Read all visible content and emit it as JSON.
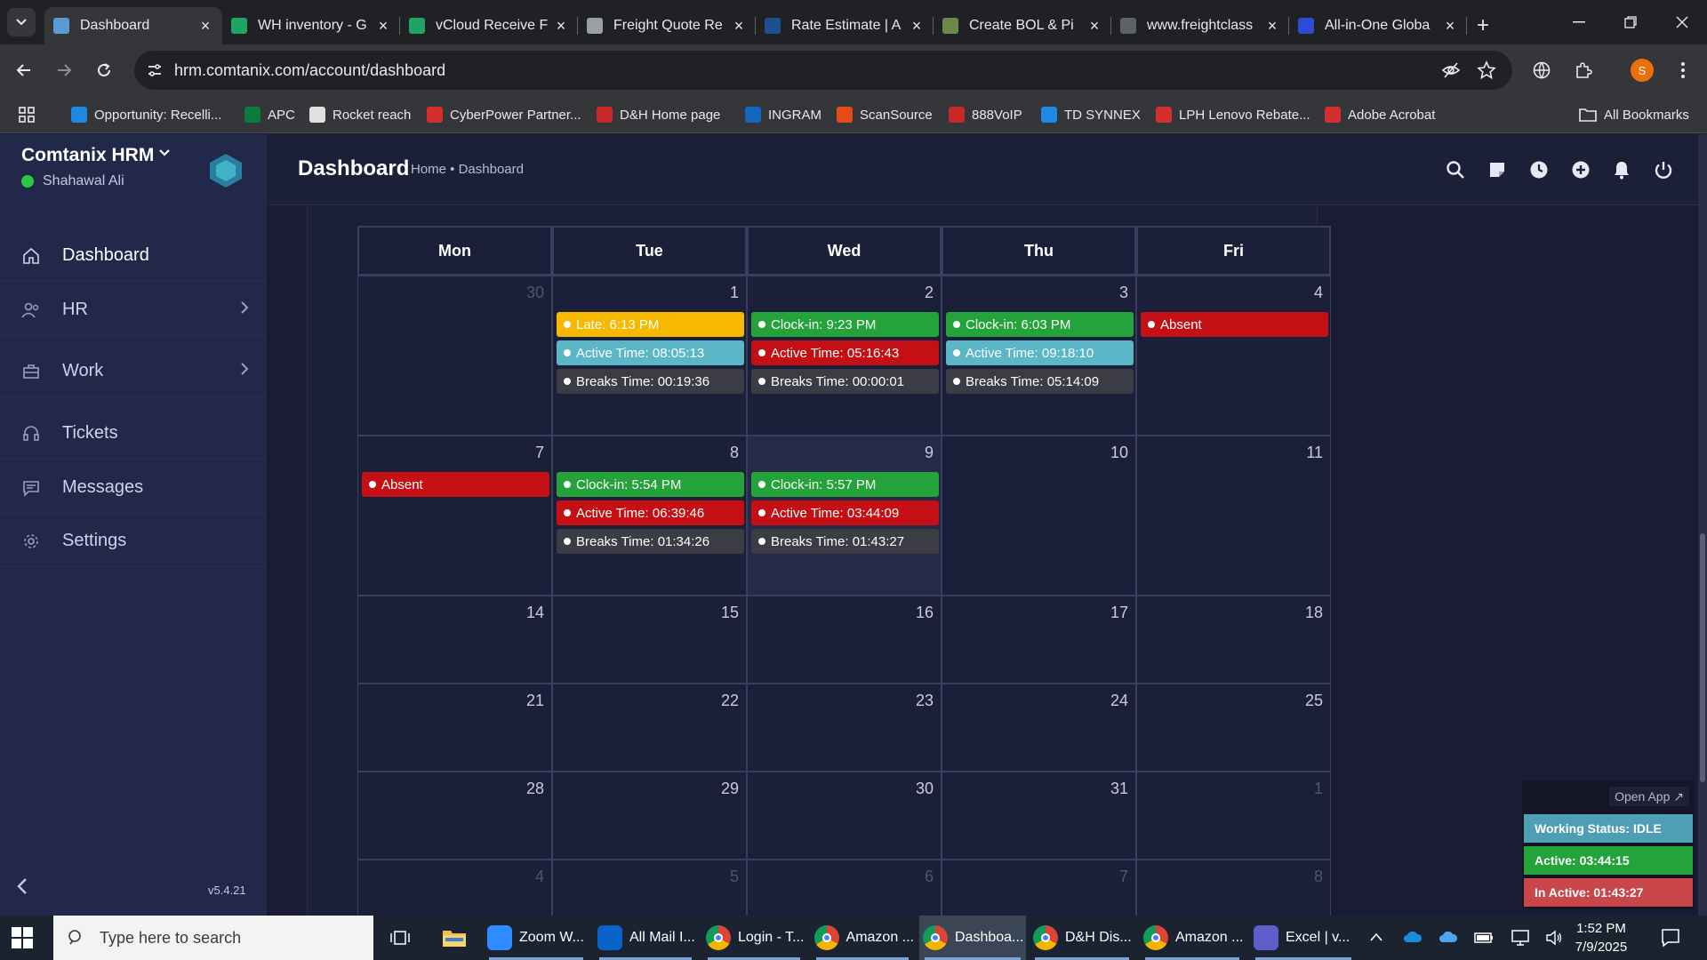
{
  "browser": {
    "tabs": [
      {
        "title": "Dashboard",
        "active": true,
        "icon": "comtanix-icon",
        "color": "#5b9bd5"
      },
      {
        "title": "WH inventory - G",
        "icon": "sheets-icon",
        "color": "#1fa463"
      },
      {
        "title": "vCloud Receive F",
        "icon": "sheets-icon",
        "color": "#1fa463"
      },
      {
        "title": "Freight Quote Re",
        "icon": "freight-icon",
        "color": "#9aa0a6"
      },
      {
        "title": "Rate Estimate | A",
        "icon": "rate-icon",
        "color": "#1d4f91"
      },
      {
        "title": "Create BOL & Pi",
        "icon": "bol-icon",
        "color": "#6a8a4a"
      },
      {
        "title": "www.freightclass",
        "icon": "fcc-icon",
        "color": "#5f6368"
      },
      {
        "title": "All-in-One Globa",
        "icon": "seventeen-icon",
        "color": "#2d4bd6"
      }
    ],
    "url": "hrm.comtanix.com/account/dashboard",
    "bookmarks": [
      {
        "label": "Opportunity: Recelli...",
        "color": "#1e88e5"
      },
      {
        "label": "APC",
        "color": "#0a7d3e"
      },
      {
        "label": "Rocket reach",
        "color": "#e0e0e0"
      },
      {
        "label": "CyberPower Partner...",
        "color": "#d32f2f"
      },
      {
        "label": "D&H Home page",
        "color": "#c62828"
      },
      {
        "label": "INGRAM",
        "color": "#1565c0"
      },
      {
        "label": "ScanSource",
        "color": "#e64a19"
      },
      {
        "label": "888VoIP",
        "color": "#c62828"
      },
      {
        "label": "TD SYNNEX",
        "color": "#1e88e5"
      },
      {
        "label": "LPH Lenovo Rebate...",
        "color": "#d32f2f"
      },
      {
        "label": "Adobe Acrobat",
        "color": "#d32f2f"
      }
    ],
    "all_bookmarks": "All Bookmarks",
    "profile_initial": "S"
  },
  "sidebar": {
    "brand": "Comtanix HRM",
    "user": "Shahawal Ali",
    "items": [
      {
        "label": "Dashboard",
        "icon": "home-icon",
        "chevron": false
      },
      {
        "label": "HR",
        "icon": "users-icon",
        "chevron": true
      },
      {
        "label": "Work",
        "icon": "briefcase-icon",
        "chevron": true
      },
      {
        "label": "Tickets",
        "icon": "headset-icon",
        "chevron": false
      },
      {
        "label": "Messages",
        "icon": "message-icon",
        "chevron": false
      },
      {
        "label": "Settings",
        "icon": "gear-icon",
        "chevron": false
      }
    ],
    "version": "v5.4.21"
  },
  "header": {
    "title": "Dashboard",
    "breadcrumb": "Home • Dashboard"
  },
  "calendar": {
    "weekdays": [
      "Mon",
      "Tue",
      "Wed",
      "Thu",
      "Fri"
    ],
    "weeks": [
      [
        {
          "day": "30",
          "other": true,
          "events": []
        },
        {
          "day": "1",
          "events": [
            {
              "text": "Late: 6:13 PM",
              "kind": "yellow"
            },
            {
              "text": "Active Time: 08:05:13",
              "kind": "teal"
            },
            {
              "text": "Breaks Time: 00:19:36",
              "kind": "dark"
            }
          ]
        },
        {
          "day": "2",
          "events": [
            {
              "text": "Clock-in: 9:23 PM",
              "kind": "green"
            },
            {
              "text": "Active Time: 05:16:43",
              "kind": "red"
            },
            {
              "text": "Breaks Time: 00:00:01",
              "kind": "dark"
            }
          ]
        },
        {
          "day": "3",
          "events": [
            {
              "text": "Clock-in: 6:03 PM",
              "kind": "green"
            },
            {
              "text": "Active Time: 09:18:10",
              "kind": "teal"
            },
            {
              "text": "Breaks Time: 05:14:09",
              "kind": "dark"
            }
          ]
        },
        {
          "day": "4",
          "events": [
            {
              "text": "Absent",
              "kind": "red"
            }
          ]
        }
      ],
      [
        {
          "day": "7",
          "events": [
            {
              "text": "Absent",
              "kind": "red"
            }
          ]
        },
        {
          "day": "8",
          "events": [
            {
              "text": "Clock-in: 5:54 PM",
              "kind": "green"
            },
            {
              "text": "Active Time: 06:39:46",
              "kind": "red"
            },
            {
              "text": "Breaks Time: 01:34:26",
              "kind": "dark"
            }
          ]
        },
        {
          "day": "9",
          "today": true,
          "events": [
            {
              "text": "Clock-in: 5:57 PM",
              "kind": "green"
            },
            {
              "text": "Active Time: 03:44:09",
              "kind": "red"
            },
            {
              "text": "Breaks Time: 01:43:27",
              "kind": "dark"
            }
          ]
        },
        {
          "day": "10",
          "events": []
        },
        {
          "day": "11",
          "events": []
        }
      ],
      [
        {
          "day": "14",
          "events": []
        },
        {
          "day": "15",
          "events": []
        },
        {
          "day": "16",
          "events": []
        },
        {
          "day": "17",
          "events": []
        },
        {
          "day": "18",
          "events": []
        }
      ],
      [
        {
          "day": "21",
          "events": []
        },
        {
          "day": "22",
          "events": []
        },
        {
          "day": "23",
          "events": []
        },
        {
          "day": "24",
          "events": []
        },
        {
          "day": "25",
          "events": []
        }
      ],
      [
        {
          "day": "28",
          "events": []
        },
        {
          "day": "29",
          "events": []
        },
        {
          "day": "30",
          "events": []
        },
        {
          "day": "31",
          "events": []
        },
        {
          "day": "1",
          "other": true,
          "events": []
        }
      ],
      [
        {
          "day": "4",
          "other": true,
          "events": []
        },
        {
          "day": "5",
          "other": true,
          "events": []
        },
        {
          "day": "6",
          "other": true,
          "events": []
        },
        {
          "day": "7",
          "other": true,
          "events": []
        },
        {
          "day": "8",
          "other": true,
          "events": []
        }
      ]
    ]
  },
  "widget": {
    "open_app": "Open App ↗",
    "working_status": "Working Status: IDLE",
    "active": "Active: 03:44:15",
    "inactive": "In Active: 01:43:27",
    "colors": {
      "status": "#4e9fb4",
      "active": "#23a33a",
      "inactive": "#c9464b"
    }
  },
  "taskbar": {
    "search_placeholder": "Type here to search",
    "apps": [
      {
        "label": "Zoom W...",
        "icon": "zoom-icon",
        "color": "#2d8cff"
      },
      {
        "label": "All Mail I...",
        "icon": "outlook-icon",
        "color": "#0a64c8"
      },
      {
        "label": "Login - T...",
        "icon": "chrome-icon",
        "color": "#db4437"
      },
      {
        "label": "Amazon ...",
        "icon": "chrome-icon",
        "color": "#db4437"
      },
      {
        "label": "Dashboa...",
        "icon": "chrome-icon",
        "color": "#db4437",
        "active": true
      },
      {
        "label": "D&H Dis...",
        "icon": "chrome-icon",
        "color": "#db4437"
      },
      {
        "label": "Amazon ...",
        "icon": "chrome-icon",
        "color": "#db4437"
      },
      {
        "label": "Excel | v...",
        "icon": "teams-icon",
        "color": "#5b5fc7"
      }
    ],
    "time": "1:52 PM",
    "date": "7/9/2025"
  }
}
